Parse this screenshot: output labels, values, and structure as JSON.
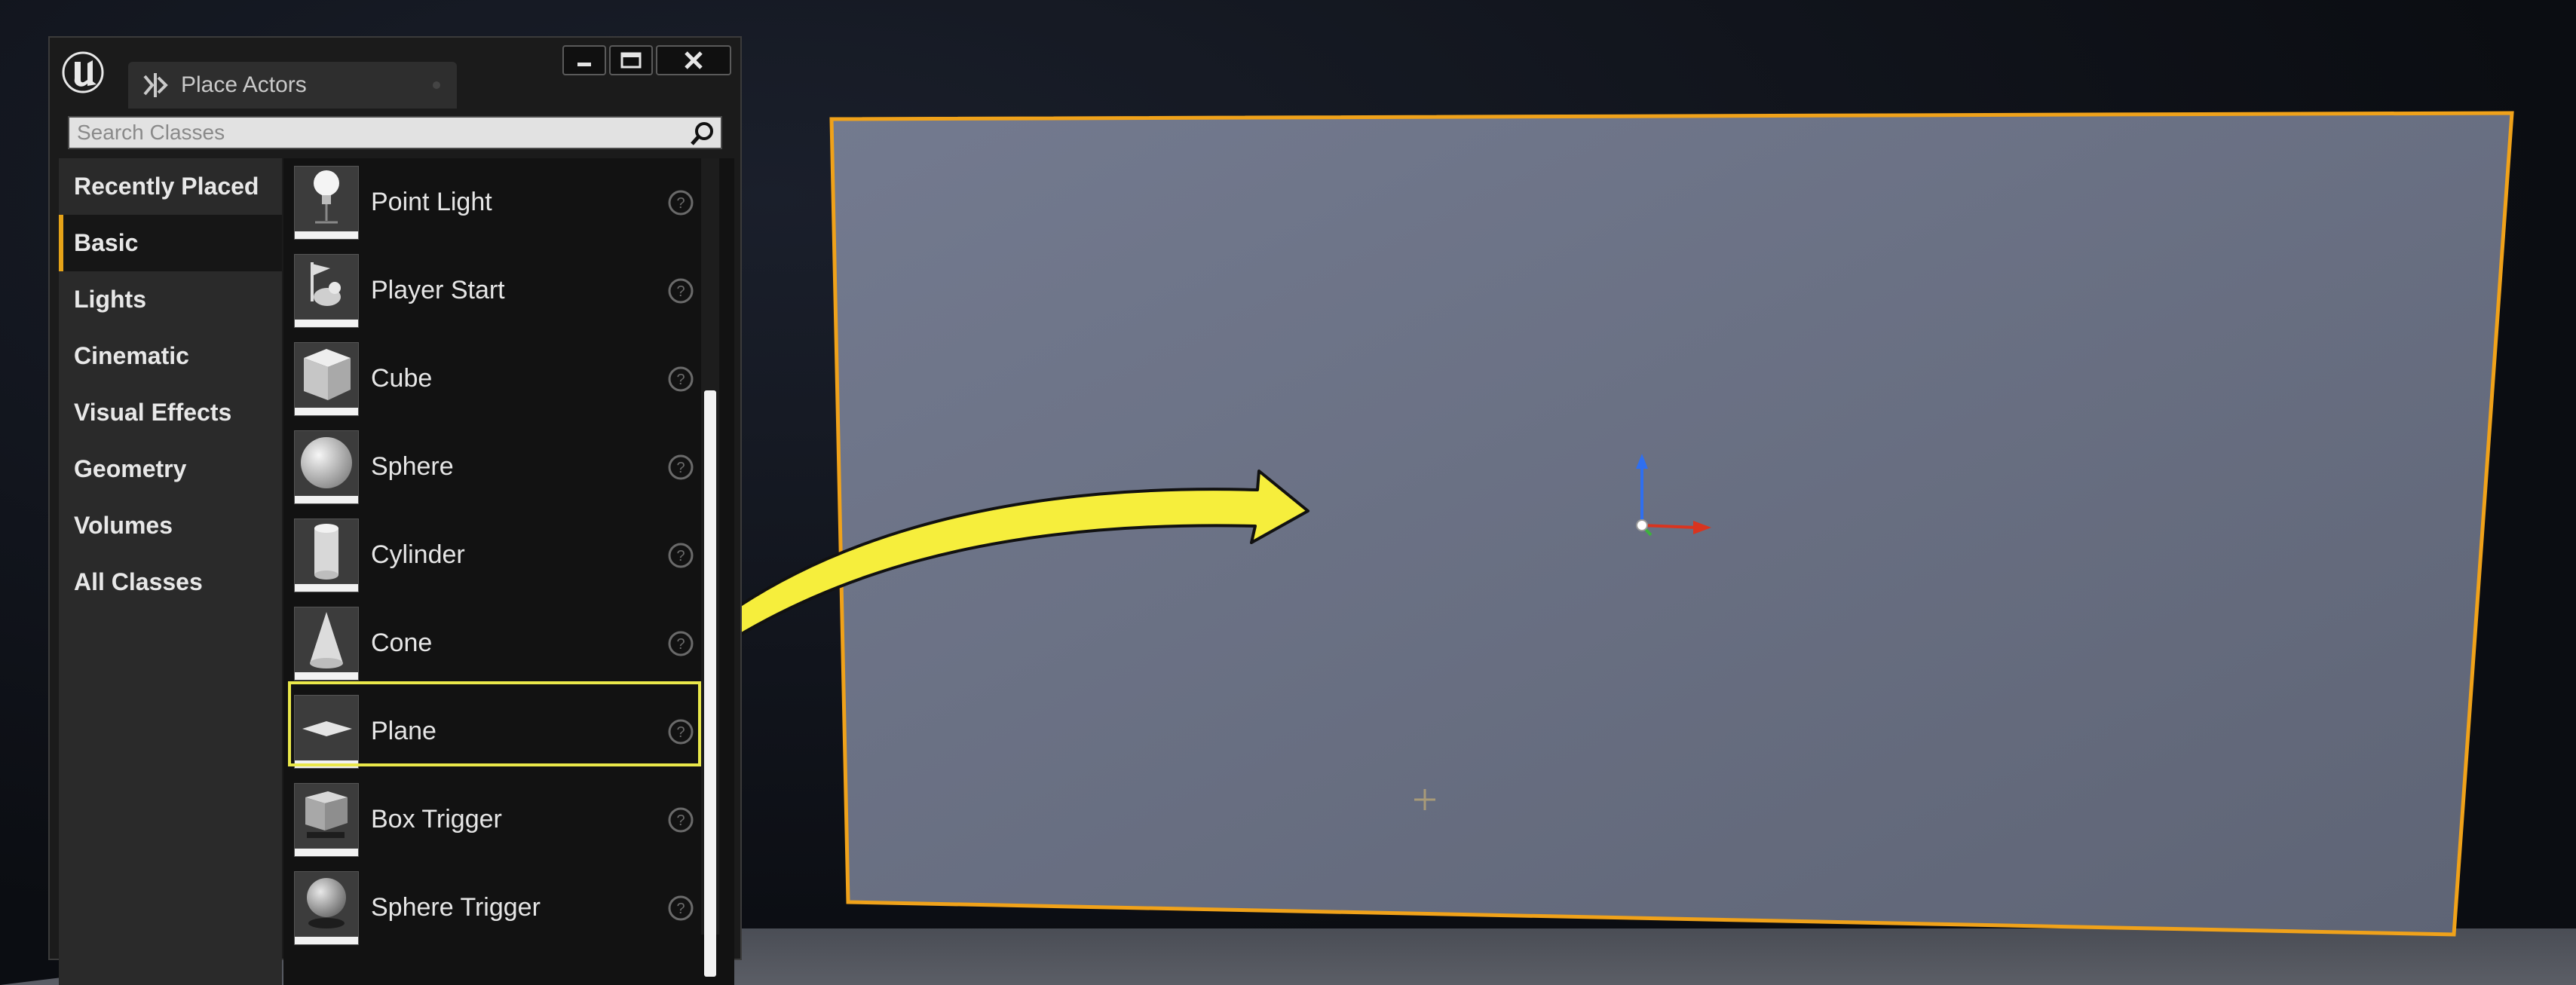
{
  "window": {
    "tab_title": "Place Actors",
    "controls": [
      "minimize",
      "maximize",
      "close"
    ]
  },
  "search": {
    "placeholder": "Search Classes",
    "value": ""
  },
  "categories": [
    {
      "label": "Recently Placed",
      "active": false
    },
    {
      "label": "Basic",
      "active": true
    },
    {
      "label": "Lights",
      "active": false
    },
    {
      "label": "Cinematic",
      "active": false
    },
    {
      "label": "Visual Effects",
      "active": false
    },
    {
      "label": "Geometry",
      "active": false
    },
    {
      "label": "Volumes",
      "active": false
    },
    {
      "label": "All Classes",
      "active": false
    }
  ],
  "actors": [
    {
      "label": "Point Light",
      "icon": "point-light-icon"
    },
    {
      "label": "Player Start",
      "icon": "player-start-icon"
    },
    {
      "label": "Cube",
      "icon": "cube-icon"
    },
    {
      "label": "Sphere",
      "icon": "sphere-icon"
    },
    {
      "label": "Cylinder",
      "icon": "cylinder-icon"
    },
    {
      "label": "Cone",
      "icon": "cone-icon"
    },
    {
      "label": "Plane",
      "icon": "plane-icon",
      "highlighted": true
    },
    {
      "label": "Box Trigger",
      "icon": "box-trigger-icon"
    },
    {
      "label": "Sphere Trigger",
      "icon": "sphere-trigger-icon"
    }
  ],
  "colors": {
    "accent": "#e6a318",
    "highlight": "#eae84a",
    "plane_fill": "#6f7689",
    "plane_border": "#f0a21a"
  }
}
